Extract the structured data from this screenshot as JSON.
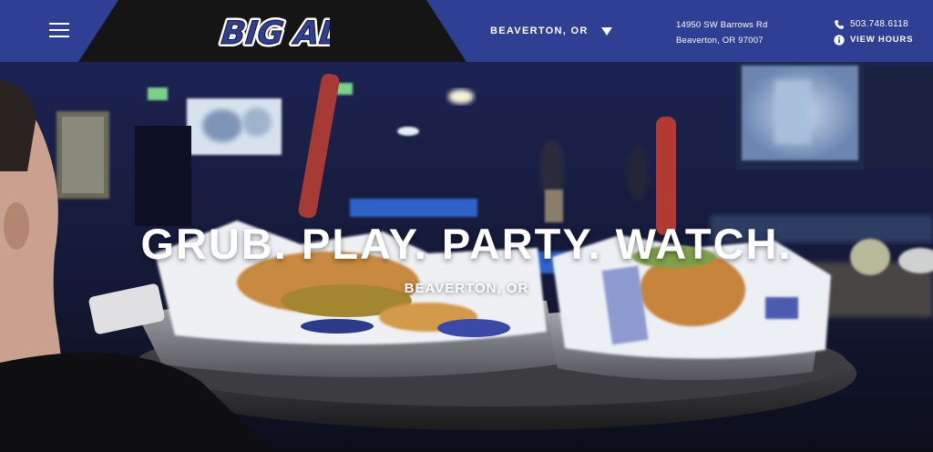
{
  "brand": {
    "logo_text": "BIG AL'S",
    "colors": {
      "header_blue": "#2f3f93",
      "header_black": "#151515",
      "text": "#ffffff"
    }
  },
  "header": {
    "menu_icon": "hamburger-icon",
    "location": {
      "label": "BEAVERTON, OR",
      "icon": "chevron-down-icon"
    },
    "address": {
      "line1": "14950 SW Barrows Rd",
      "line2": "Beaverton, OR 97007"
    },
    "phone": {
      "icon": "phone-icon",
      "number": "503.748.6118"
    },
    "hours": {
      "icon": "info-icon",
      "label": "VIEW HOURS"
    }
  },
  "hero": {
    "headline": "GRUB. PLAY. PARTY. WATCH.",
    "subheadline": "BEAVERTON, OR",
    "background": "video-still-food-tray"
  }
}
